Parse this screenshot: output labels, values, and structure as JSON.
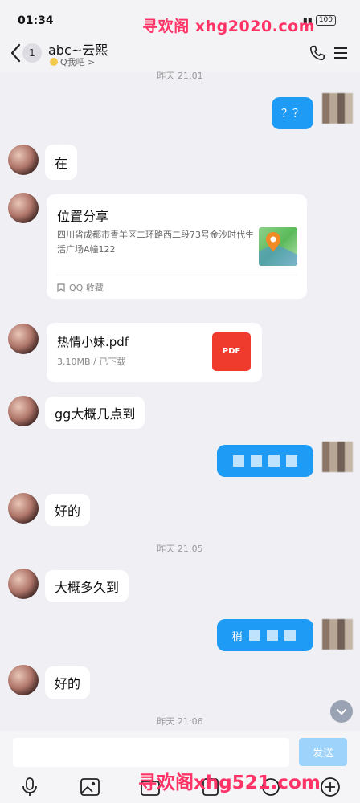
{
  "status_bar": {
    "time": "01:34",
    "battery": "100",
    "watermark": "寻欢阁 xhg2020.com"
  },
  "header": {
    "unread_count": "1",
    "title": "abc~云熙",
    "subtitle": "Q我吧 >"
  },
  "messages": {
    "ts_1": "昨天 21:01",
    "right_1": "？？",
    "left_1": "在",
    "location": {
      "title": "位置分享",
      "address": "四川省成都市青羊区二环路西二段73号金沙时代生活广场A幢122",
      "source": "QQ 收藏"
    },
    "file": {
      "name": "热情小妹.pdf",
      "meta": "3.10MB / 已下载",
      "icon_label": "PDF"
    },
    "left_2": "gg大概几点到",
    "left_3": "好的",
    "ts_2": "昨天 21:05",
    "left_4": "大概多久到",
    "right_3_prefix": "稍",
    "left_5": "好的",
    "ts_3": "昨天 21:06"
  },
  "input_bar": {
    "send_label": "发送",
    "watermark": "寻欢阁xhg521.com"
  },
  "colors": {
    "accent_blue": "#1e9bf5",
    "send_disabled": "#9ed3fb",
    "background": "#efeff4"
  }
}
